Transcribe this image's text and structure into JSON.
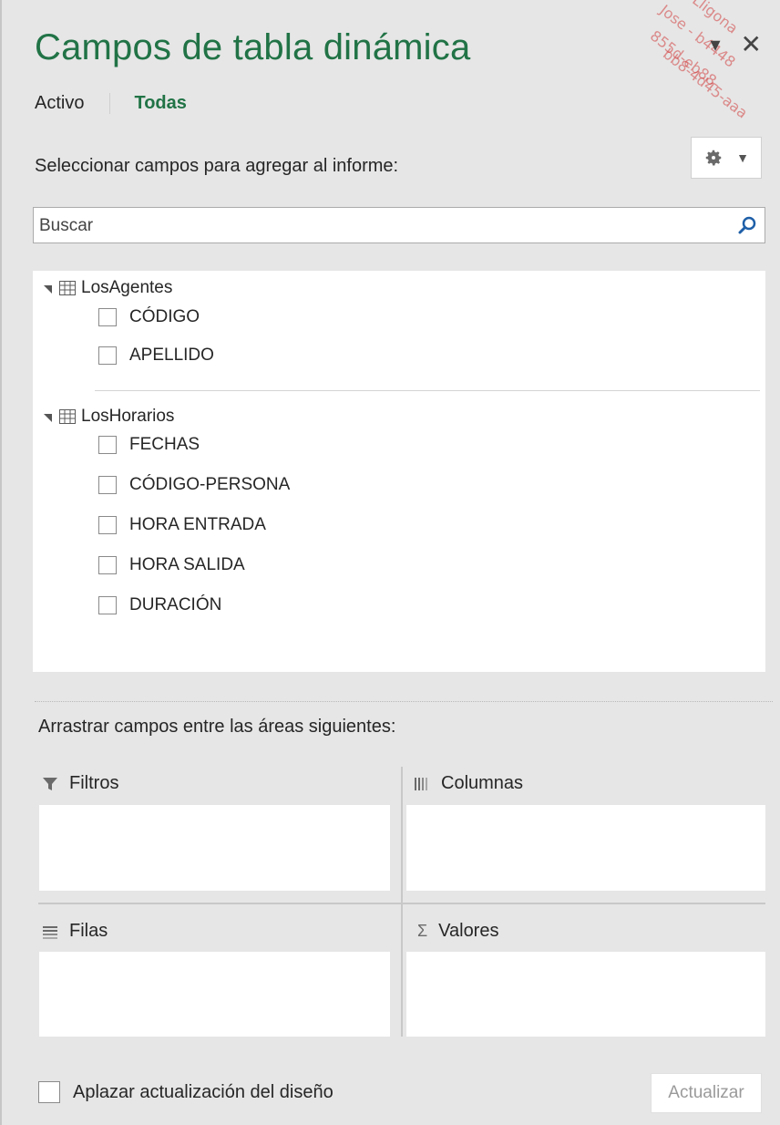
{
  "pane": {
    "title": "Campos de tabla dinámica",
    "tabs": [
      {
        "label": "Activo",
        "active": false
      },
      {
        "label": "Todas",
        "active": true
      }
    ],
    "select_label": "Seleccionar campos para agregar al informe:",
    "search": {
      "placeholder": "Buscar",
      "value": ""
    }
  },
  "watermark": [
    "Lligona",
    "Jose - b4448",
    "855d-eb88-",
    "bb8-4d45-aaa"
  ],
  "tables": [
    {
      "name": "LosAgentes",
      "fields": [
        {
          "label": "CÓDIGO",
          "checked": false
        },
        {
          "label": "APELLIDO",
          "checked": false
        }
      ]
    },
    {
      "name": "LosHorarios",
      "fields": [
        {
          "label": "FECHAS",
          "checked": false
        },
        {
          "label": "CÓDIGO-PERSONA",
          "checked": false
        },
        {
          "label": "HORA ENTRADA",
          "checked": false
        },
        {
          "label": "HORA SALIDA",
          "checked": false
        },
        {
          "label": "DURACIÓN",
          "checked": false
        }
      ]
    }
  ],
  "areas": {
    "drag_label": "Arrastrar campos entre las áreas siguientes:",
    "filters": "Filtros",
    "columns": "Columnas",
    "rows": "Filas",
    "values": "Valores"
  },
  "footer": {
    "defer_label": "Aplazar actualización del diseño",
    "defer_checked": false,
    "update_button": "Actualizar"
  },
  "colors": {
    "accent": "#217346",
    "pane_bg": "#e6e6e6"
  }
}
